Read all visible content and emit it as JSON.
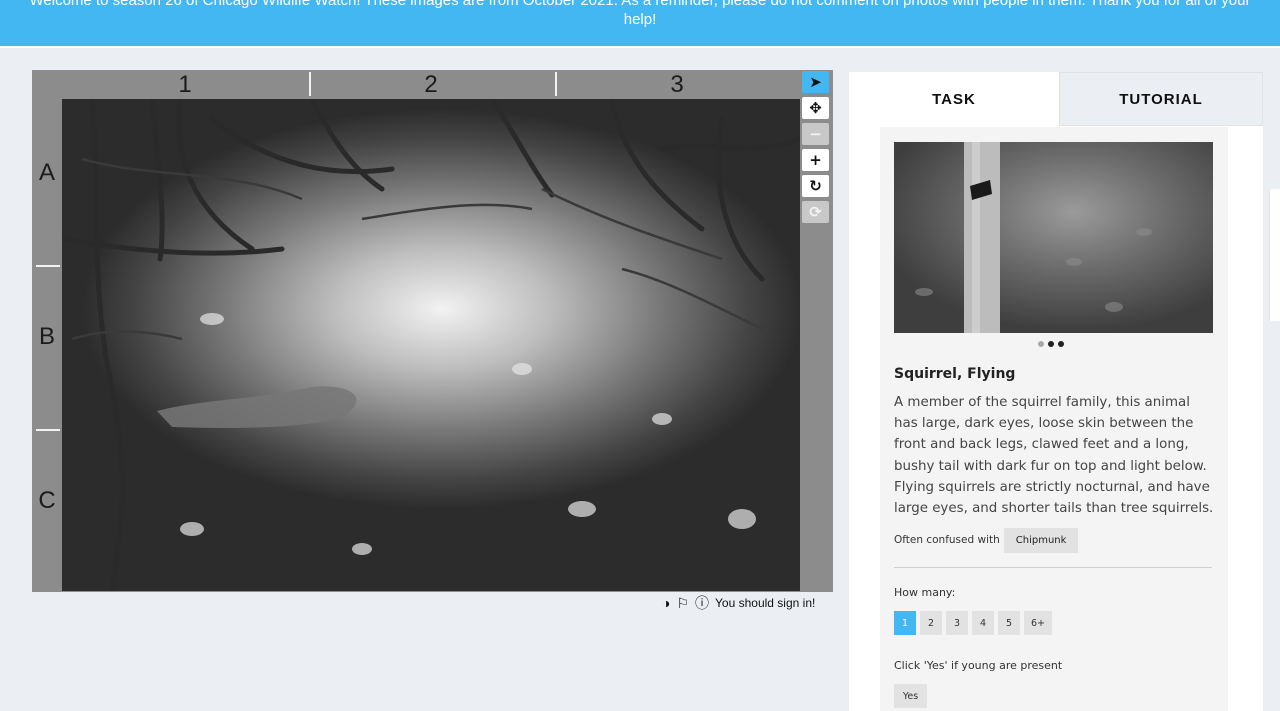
{
  "banner": {
    "line1": "Welcome to season 26 of Chicago Wildlife Watch! These images are from October 2021. As a reminder, please do not comment on photos with people in them. Thank you for all of your",
    "line2": "help!"
  },
  "viewer": {
    "columns": [
      "1",
      "2",
      "3"
    ],
    "rows": [
      "A",
      "B",
      "C"
    ]
  },
  "toolbar": {
    "icons": [
      "pointer-icon",
      "move-icon",
      "zoom-out-icon",
      "zoom-in-icon",
      "rotate-icon",
      "reset-icon"
    ]
  },
  "meta": {
    "sign_in": "You should sign in!"
  },
  "tabs": {
    "task": "TASK",
    "tutorial": "TUTORIAL"
  },
  "species": {
    "name": "Squirrel, Flying",
    "description": "A member of the squirrel family, this animal has large, dark eyes, loose skin between the front and back legs, clawed feet and a long, bushy tail with dark fur on top and light below. Flying squirrels are strictly nocturnal, and have large eyes, and shorter tails than tree squirrels.",
    "confused_label": "Often confused with",
    "confused_with": "Chipmunk",
    "carousel_total": 3,
    "carousel_current": 2
  },
  "questions": {
    "how_many_label": "How many:",
    "counts": [
      "1",
      "2",
      "3",
      "4",
      "5",
      "6+"
    ],
    "selected_count": "1",
    "young_label": "Click 'Yes' if young are present",
    "yes_label": "Yes"
  },
  "colors": {
    "accent": "#43b7f2",
    "background": "#ebeff4"
  }
}
